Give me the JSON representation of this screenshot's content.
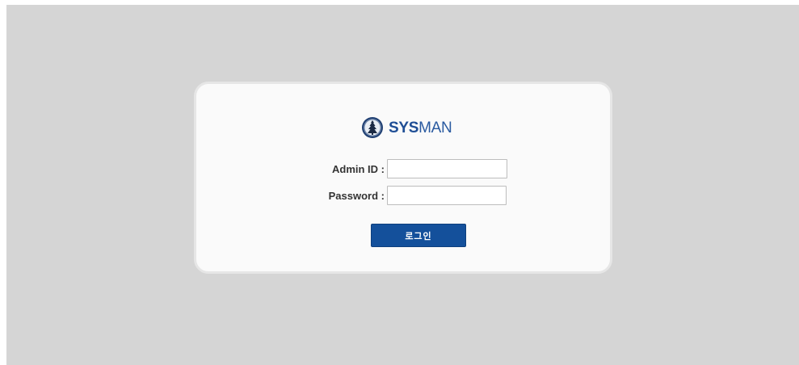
{
  "logo": {
    "brand_bold": "SYS",
    "brand_light": "MAN",
    "icon": "emblem-icon",
    "color": "#1f4e95"
  },
  "form": {
    "admin_id_label": "Admin ID :",
    "admin_id_value": "",
    "password_label": "Password :",
    "password_value": "",
    "login_button_label": "로그인",
    "button_color": "#14509b"
  }
}
